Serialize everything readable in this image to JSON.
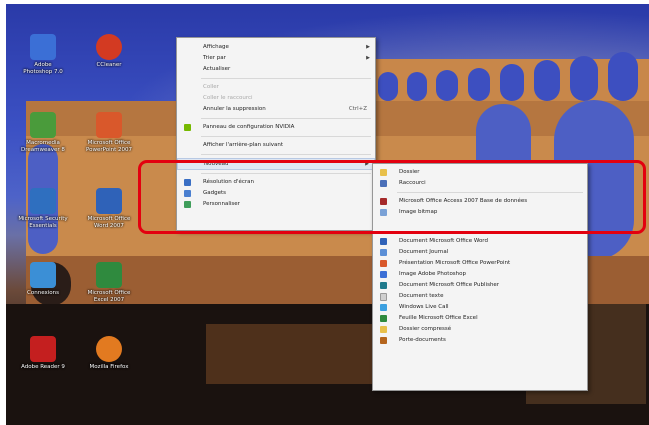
{
  "desktop_icons": [
    {
      "id": "photoshop",
      "label": "Adobe\nPhotoshop 7.0",
      "icon": "photoshop-icon",
      "color": "#3b6fd6"
    },
    {
      "id": "ccleaner",
      "label": "CCleaner",
      "icon": "ccleaner-icon",
      "color": "#d33a22"
    },
    {
      "id": "dreamweaver",
      "label": "Macromedia\nDreamweaver 8",
      "icon": "dreamweaver-icon",
      "color": "#4a9b3b"
    },
    {
      "id": "powerpoint",
      "label": "Microsoft Office\nPowerPoint 2007",
      "icon": "powerpoint-icon",
      "color": "#d9582b"
    },
    {
      "id": "security-essentials",
      "label": "Microsoft Security\nEssentials",
      "icon": "security-essentials-icon",
      "color": "#2f6fbf"
    },
    {
      "id": "word",
      "label": "Microsoft Office\nWord 2007",
      "icon": "word-icon",
      "color": "#2f62b8"
    },
    {
      "id": "connections",
      "label": "Connexions",
      "icon": "network-icon",
      "color": "#3b8fd6"
    },
    {
      "id": "excel",
      "label": "Microsoft Office\nExcel 2007",
      "icon": "excel-icon",
      "color": "#2f8a3e"
    },
    {
      "id": "adobe-reader",
      "label": "Adobe Reader 9",
      "icon": "adobe-reader-icon",
      "color": "#c41f1f"
    },
    {
      "id": "firefox",
      "label": "Mozilla Firefox",
      "icon": "firefox-icon",
      "color": "#e27a20"
    }
  ],
  "context_menu": {
    "items": [
      {
        "label": "Affichage",
        "has_submenu": true
      },
      {
        "label": "Trier par",
        "has_submenu": true
      },
      {
        "label": "Actualiser"
      },
      {
        "separator": true
      },
      {
        "label": "Coller",
        "disabled": true
      },
      {
        "label": "Coller le raccourci",
        "disabled": true
      },
      {
        "label": "Annuler la suppression",
        "shortcut": "Ctrl+Z"
      },
      {
        "separator": true
      },
      {
        "label": "Panneau de configuration NVIDIA",
        "icon": "nvidia-icon"
      },
      {
        "separator": true
      },
      {
        "label": "Afficher l'arrière-plan suivant"
      },
      {
        "separator": true
      },
      {
        "label": "Nouveau",
        "has_submenu": true,
        "highlighted": true
      },
      {
        "separator": true
      },
      {
        "label": "Résolution d'écran",
        "icon": "display-icon"
      },
      {
        "label": "Gadgets",
        "icon": "gadgets-icon"
      },
      {
        "label": "Personnaliser",
        "icon": "personalize-icon"
      }
    ]
  },
  "new_submenu": {
    "items": [
      {
        "label": "Dossier",
        "icon": "folder-icon",
        "color": "#e8c04a"
      },
      {
        "label": "Raccourci",
        "icon": "shortcut-icon",
        "color": "#4a6fb8"
      },
      {
        "separator": true
      },
      {
        "label": "Microsoft Office Access 2007 Base de données",
        "icon": "access-icon",
        "color": "#a52a2a"
      },
      {
        "label": "Image bitmap",
        "icon": "bitmap-icon",
        "color": "#7aa1d6"
      },
      {
        "separator": true
      },
      {
        "label": "Document Microsoft Office Word",
        "icon": "word-doc-icon",
        "color": "#2f62b8"
      },
      {
        "label": "Document Journal",
        "icon": "journal-icon",
        "color": "#5b8fd6"
      },
      {
        "label": "Présentation Microsoft Office PowerPoint",
        "icon": "ppt-doc-icon",
        "color": "#d9582b"
      },
      {
        "label": "Image Adobe Photoshop",
        "icon": "psd-doc-icon",
        "color": "#3b6fd6"
      },
      {
        "label": "Document Microsoft Office Publisher",
        "icon": "publisher-doc-icon",
        "color": "#1f7a8c"
      },
      {
        "label": "Document texte",
        "icon": "text-doc-icon",
        "color": "#cfcfcf"
      },
      {
        "label": "Windows Live Call",
        "icon": "live-call-icon",
        "color": "#3ca0e0"
      },
      {
        "label": "Feuille Microsoft Office Excel",
        "icon": "excel-doc-icon",
        "color": "#2f8a3e"
      },
      {
        "label": "Dossier compressé",
        "icon": "zip-folder-icon",
        "color": "#e8c04a"
      },
      {
        "label": "Porte-documents",
        "icon": "briefcase-icon",
        "color": "#b5651d"
      }
    ]
  }
}
